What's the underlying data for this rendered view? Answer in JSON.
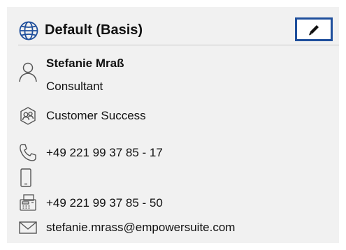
{
  "card": {
    "title": "Default (Basis)",
    "title_icon": "globe-icon",
    "edit_icon": "pencil-icon"
  },
  "person": {
    "name": "Stefanie Mraß",
    "role": "Consultant",
    "icon": "person-icon"
  },
  "department": {
    "label": "Customer Success",
    "icon": "team-icon"
  },
  "contact": {
    "phone": "+49 221 99 37 85 - 17",
    "phone_icon": "phone-icon",
    "mobile": "",
    "mobile_icon": "mobile-icon",
    "fax": "+49 221 99 37 85 - 50",
    "fax_icon": "fax-icon",
    "email": "stefanie.mrass@empowersuite.com",
    "email_icon": "mail-icon"
  },
  "colors": {
    "card_background": "#f1f1f1",
    "accent_border": "#1f4f9c"
  }
}
